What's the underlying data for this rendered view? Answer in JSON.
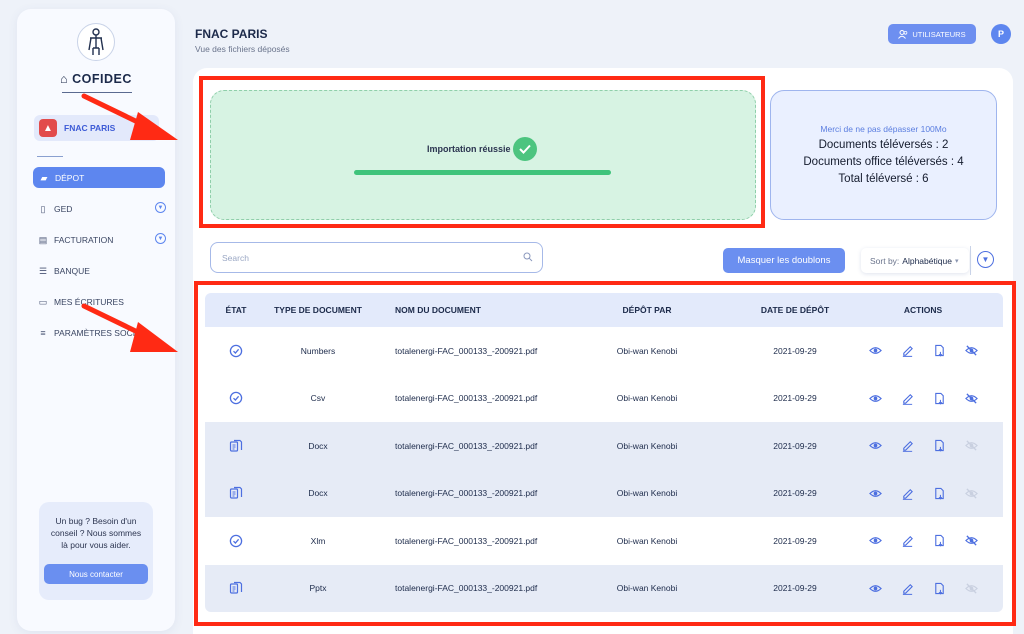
{
  "sidebar": {
    "brand": "COFIDEC",
    "company": "FNAC PARIS",
    "nav": [
      {
        "label": "DÉPOT",
        "icon": "folder-icon",
        "active": true
      },
      {
        "label": "GED",
        "icon": "document-icon",
        "expandable": true
      },
      {
        "label": "FACTURATION",
        "icon": "invoice-icon",
        "expandable": true
      },
      {
        "label": "BANQUE",
        "icon": "bank-icon"
      },
      {
        "label": "MES ÉCRITURES",
        "icon": "writing-icon"
      },
      {
        "label": "PARAMÈTRES SOCIÉ",
        "icon": "settings-sliders-icon"
      }
    ],
    "help_text": "Un bug ? Besoin d'un conseil ? Nous sommes là pour vous aider.",
    "help_button": "Nous contacter"
  },
  "header": {
    "title": "FNAC PARIS",
    "subtitle": "Vue des fichiers déposés",
    "users_button": "UTILISATEURS",
    "avatar_initial": "P"
  },
  "upload": {
    "message": "Importation réussie",
    "progress": 1.0
  },
  "stats": {
    "note": "Merci de ne pas dépasser 100Mo",
    "line1": "Documents téléversés : 2",
    "line2": "Documents office téléversés : 4",
    "line3": "Total téléversé : 6"
  },
  "toolbar": {
    "search_placeholder": "Search",
    "dedupe_button": "Masquer les doublons",
    "sort_prefix": "Sort by:",
    "sort_value": "Alphabétique"
  },
  "table": {
    "headers": [
      "ÉTAT",
      "TYPE DE DOCUMENT",
      "NOM DU DOCUMENT",
      "DÉPÔT PAR",
      "DATE DE DÉPÔT",
      "ACTIONS"
    ],
    "rows": [
      {
        "state": "check-circle-icon",
        "type": "Numbers",
        "name": "totalenergi-FAC_000133_-200921.pdf",
        "by": "Obi-wan Kenobi",
        "date": "2021-09-29",
        "alt": false,
        "hide_active": true
      },
      {
        "state": "check-circle-icon",
        "type": "Csv",
        "name": "totalenergi-FAC_000133_-200921.pdf",
        "by": "Obi-wan Kenobi",
        "date": "2021-09-29",
        "alt": false,
        "hide_active": true
      },
      {
        "state": "office-doc-icon",
        "type": "Docx",
        "name": "totalenergi-FAC_000133_-200921.pdf",
        "by": "Obi-wan Kenobi",
        "date": "2021-09-29",
        "alt": true,
        "hide_active": false
      },
      {
        "state": "office-doc-icon",
        "type": "Docx",
        "name": "totalenergi-FAC_000133_-200921.pdf",
        "by": "Obi-wan Kenobi",
        "date": "2021-09-29",
        "alt": true,
        "hide_active": false
      },
      {
        "state": "check-circle-icon",
        "type": "Xlm",
        "name": "totalenergi-FAC_000133_-200921.pdf",
        "by": "Obi-wan Kenobi",
        "date": "2021-09-29",
        "alt": false,
        "hide_active": true
      },
      {
        "state": "office-doc-icon",
        "type": "Pptx",
        "name": "totalenergi-FAC_000133_-200921.pdf",
        "by": "Obi-wan Kenobi",
        "date": "2021-09-29",
        "alt": true,
        "hide_active": false
      }
    ]
  },
  "colors": {
    "accent": "#5d86ef",
    "success": "#4cc47f",
    "highlight": "#ff2a14"
  }
}
